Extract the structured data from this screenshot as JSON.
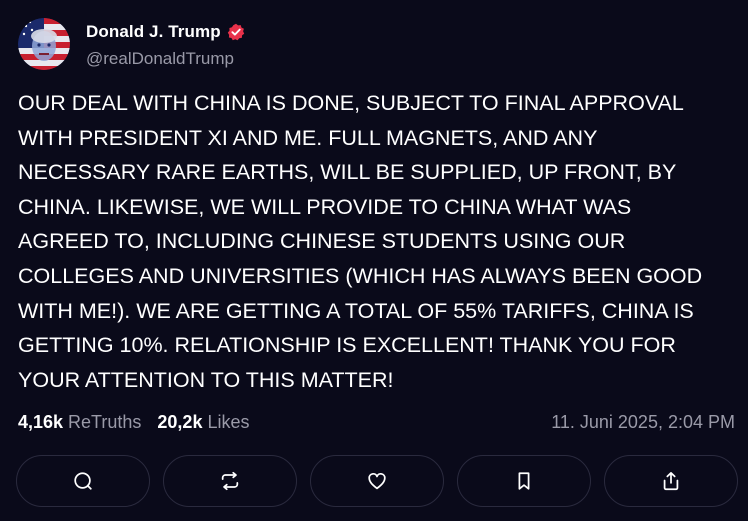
{
  "author": {
    "display_name": "Donald J. Trump",
    "handle": "@realDonaldTrump",
    "verified_color": "#e8314a"
  },
  "post": {
    "text": "OUR DEAL WITH CHINA IS DONE, SUBJECT TO FINAL APPROVAL\nWITH PRESIDENT XI AND ME. FULL MAGNETS, AND ANY\nNECESSARY RARE EARTHS, WILL BE SUPPLIED, UP FRONT, BY\nCHINA. LIKEWISE, WE WILL PROVIDE TO CHINA WHAT WAS\nAGREED TO, INCLUDING CHINESE STUDENTS USING OUR\nCOLLEGES AND UNIVERSITIES (WHICH HAS ALWAYS BEEN GOOD\nWITH ME!). WE ARE GETTING A TOTAL OF 55% TARIFFS, CHINA IS\nGETTING 10%. RELATIONSHIP IS EXCELLENT! THANK YOU FOR\nYOUR ATTENTION TO THIS MATTER!",
    "retruths_count": "4,16k",
    "retruths_label": "ReTruths",
    "likes_count": "20,2k",
    "likes_label": "Likes",
    "timestamp": "11. Juni 2025, 2:04 PM"
  },
  "actions": [
    {
      "name": "reply",
      "icon": "reply-icon"
    },
    {
      "name": "retruth",
      "icon": "retruth-icon"
    },
    {
      "name": "like",
      "icon": "heart-icon"
    },
    {
      "name": "bookmark",
      "icon": "bookmark-icon"
    },
    {
      "name": "share",
      "icon": "share-icon"
    }
  ],
  "colors": {
    "background": "#0a0a1a",
    "secondary_text": "#9a9aa8",
    "button_border": "#2a2a3e"
  }
}
